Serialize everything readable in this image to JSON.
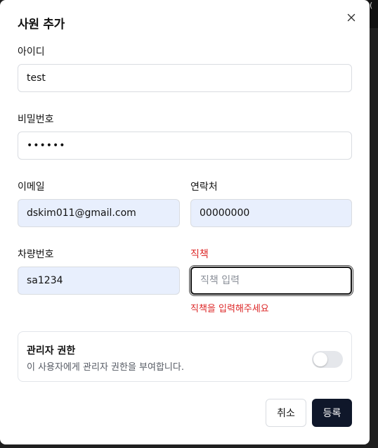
{
  "background_corner_text": "(",
  "dialog": {
    "title": "사원 추가",
    "close_icon": "close-icon"
  },
  "form": {
    "id": {
      "label": "아이디",
      "value": "test"
    },
    "password": {
      "label": "비밀번호",
      "value": "••••••"
    },
    "email": {
      "label": "이메일",
      "value": "dskim011@gmail.com"
    },
    "phone": {
      "label": "연락처",
      "value": "00000000"
    },
    "car_number": {
      "label": "차량번호",
      "value": "sa1234"
    },
    "position": {
      "label": "직책",
      "value": "",
      "placeholder": "직책 입력",
      "error": "직책을 입력해주세요"
    }
  },
  "admin": {
    "title": "관리자 권한",
    "description": "이 사용자에게 관리자 권한을 부여합니다.",
    "enabled": false
  },
  "buttons": {
    "cancel": "취소",
    "submit": "등록"
  },
  "colors": {
    "error": "#dc2626",
    "autofill_bg": "#e8effd",
    "primary_button": "#0f172a"
  }
}
